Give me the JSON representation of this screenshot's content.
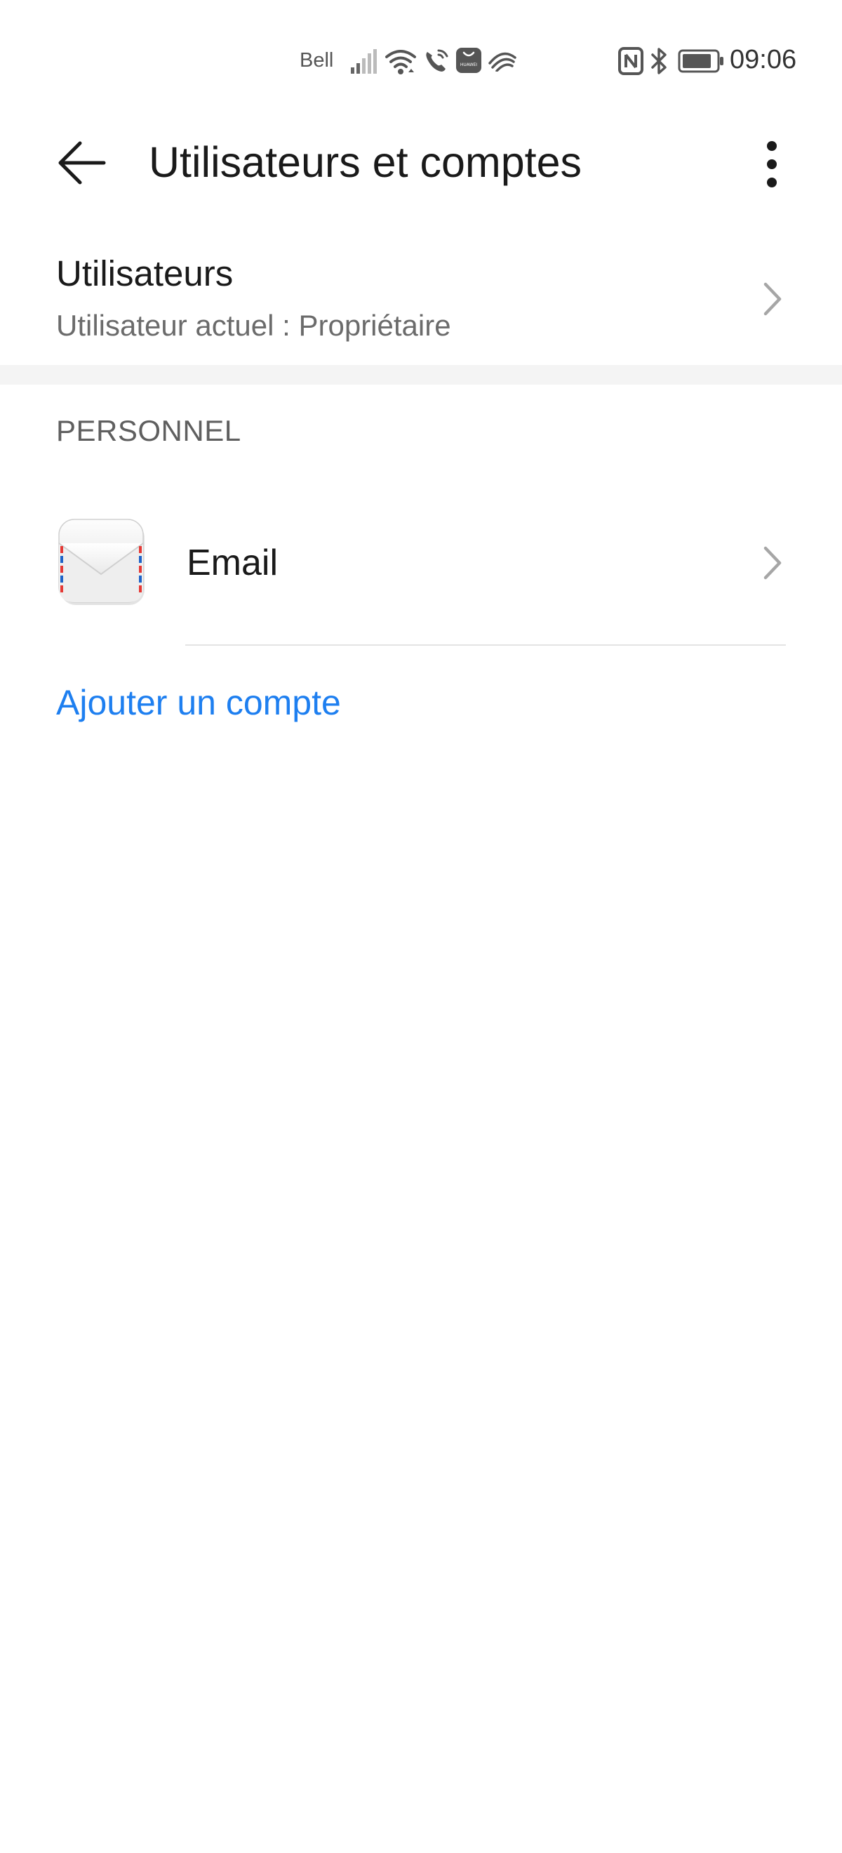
{
  "status_bar": {
    "carrier": "Bell",
    "time": "09:06",
    "icons": [
      "signal-icon",
      "wifi-icon",
      "wifi-calling-icon",
      "huawei-appgallery-icon",
      "swiftkey-icon",
      "nfc-icon",
      "bluetooth-icon",
      "battery-icon"
    ],
    "appgallery_text": "HUAWEI"
  },
  "header": {
    "title": "Utilisateurs et comptes",
    "back_icon": "back-arrow-icon",
    "more_icon": "more-vertical-icon"
  },
  "users": {
    "title": "Utilisateurs",
    "subtitle": "Utilisateur actuel : Propriétaire"
  },
  "personal_section": {
    "header": "PERSONNEL",
    "accounts": [
      {
        "label": "Email",
        "icon": "email-envelope-icon"
      }
    ],
    "add_account_label": "Ajouter un compte"
  },
  "colors": {
    "accent": "#1e7ff0",
    "primary_text": "#1a1a1a",
    "secondary_text": "#6b6b6b",
    "divider": "#e3e3e3",
    "section_background": "#f4f4f4"
  }
}
